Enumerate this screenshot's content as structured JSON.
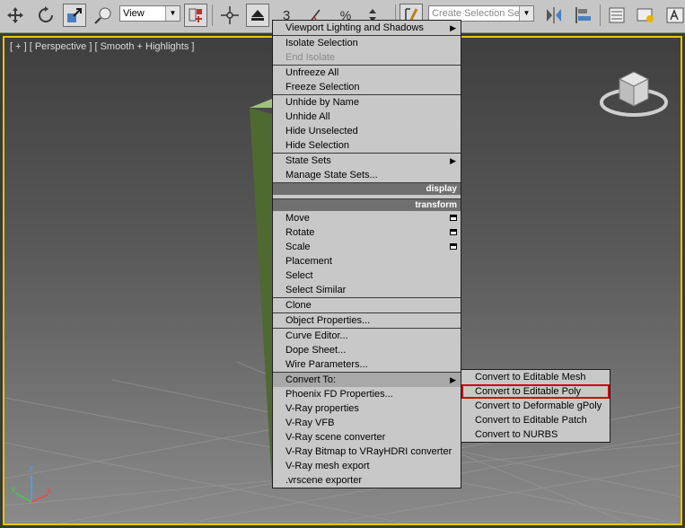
{
  "toolbar": {
    "view_dropdown": "View",
    "create_selection_placeholder": "Create Selection Se",
    "number_3": "3",
    "percent": "%"
  },
  "viewport": {
    "label": "[ + ] [ Perspective ] [ Smooth + Highlights ]",
    "axis": {
      "z": "z",
      "y": "y",
      "x": "x"
    }
  },
  "menu": {
    "items_top": [
      {
        "label": "Viewport Lighting and Shadows",
        "submenu": true
      },
      {
        "label": "Isolate Selection"
      },
      {
        "label": "End Isolate",
        "disabled": true
      },
      {
        "label": "Unfreeze All"
      },
      {
        "label": "Freeze Selection"
      },
      {
        "label": "Unhide by Name"
      },
      {
        "label": "Unhide All"
      },
      {
        "label": "Hide Unselected"
      },
      {
        "label": "Hide Selection"
      },
      {
        "label": "State Sets",
        "submenu": true
      },
      {
        "label": "Manage State Sets..."
      }
    ],
    "header_display": "display",
    "header_transform": "transform",
    "items_transform": [
      {
        "label": "Move",
        "settings_icon": true
      },
      {
        "label": "Rotate",
        "settings_icon": true
      },
      {
        "label": "Scale",
        "settings_icon": true
      },
      {
        "label": "Placement"
      },
      {
        "label": "Select"
      },
      {
        "label": "Select Similar"
      },
      {
        "label": "Clone"
      },
      {
        "label": "Object Properties..."
      },
      {
        "label": "Curve Editor..."
      },
      {
        "label": "Dope Sheet..."
      },
      {
        "label": "Wire Parameters..."
      },
      {
        "label": "Convert To:",
        "submenu": true
      },
      {
        "label": "Phoenix FD Properties..."
      },
      {
        "label": "V-Ray properties"
      },
      {
        "label": "V-Ray VFB"
      },
      {
        "label": "V-Ray scene converter"
      },
      {
        "label": "V-Ray Bitmap to VRayHDRI converter"
      },
      {
        "label": "V-Ray mesh export"
      },
      {
        "label": ".vrscene exporter"
      }
    ]
  },
  "submenu_convert": {
    "items": [
      {
        "label": "Convert to Editable Mesh"
      },
      {
        "label": "Convert to Editable Poly",
        "selected": true
      },
      {
        "label": "Convert to Deformable gPoly"
      },
      {
        "label": "Convert to Editable Patch"
      },
      {
        "label": "Convert to NURBS"
      }
    ]
  },
  "colors": {
    "viewport_border": "#e8c400",
    "menu_bg": "#c8c8c8",
    "menu_header": "#707070",
    "selection_outline": "#d00000",
    "object_green": "#5e7a3c"
  }
}
